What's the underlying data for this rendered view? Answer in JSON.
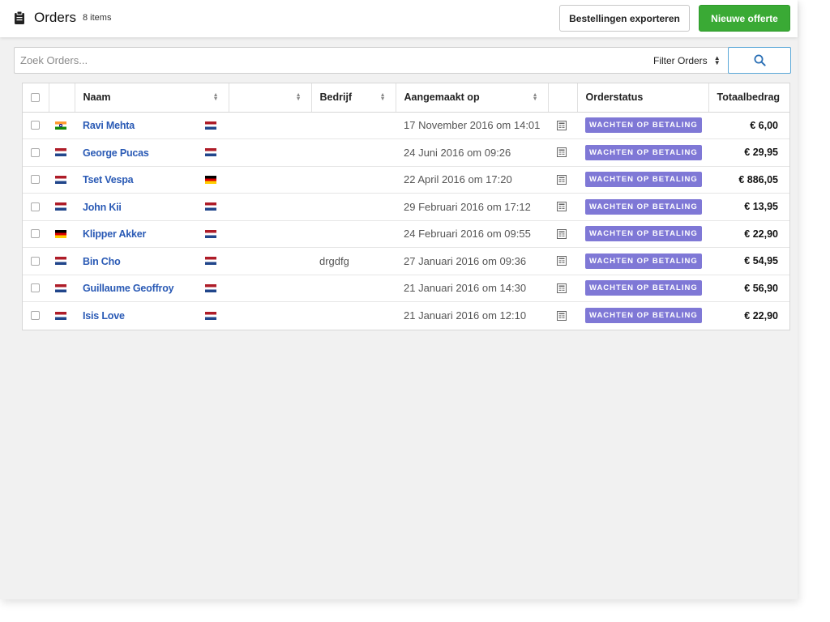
{
  "header": {
    "title": "Orders",
    "count": "8 items",
    "export_label": "Bestellingen exporteren",
    "new_label": "Nieuwe offerte",
    "title_icon": "clipboard-icon"
  },
  "search": {
    "placeholder": "Zoek Orders...",
    "filter_label": "Filter Orders",
    "button_icon": "search-icon"
  },
  "table": {
    "columns": {
      "name": "Naam",
      "company": "Bedrijf",
      "created": "Aangemaakt op",
      "status": "Orderstatus",
      "total": "Totaalbedrag"
    },
    "rows": [
      {
        "country": "in",
        "name": "Ravi Mehta",
        "nationality": "nl",
        "company": "",
        "created": "17 November 2016 om 14:01",
        "status": "WACHTEN OP BETALING",
        "total": "€ 6,00"
      },
      {
        "country": "nl",
        "name": "George Pucas",
        "nationality": "nl",
        "company": "",
        "created": "24 Juni 2016 om 09:26",
        "status": "WACHTEN OP BETALING",
        "total": "€ 29,95"
      },
      {
        "country": "nl",
        "name": "Tset Vespa",
        "nationality": "de",
        "company": "",
        "created": "22 April 2016 om 17:20",
        "status": "WACHTEN OP BETALING",
        "total": "€ 886,05"
      },
      {
        "country": "nl",
        "name": "John Kii",
        "nationality": "nl",
        "company": "",
        "created": "29 Februari 2016 om 17:12",
        "status": "WACHTEN OP BETALING",
        "total": "€ 13,95"
      },
      {
        "country": "de",
        "name": "Klipper Akker",
        "nationality": "nl",
        "company": "",
        "created": "24 Februari 2016 om 09:55",
        "status": "WACHTEN OP BETALING",
        "total": "€ 22,90"
      },
      {
        "country": "nl",
        "name": "Bin Cho",
        "nationality": "nl",
        "company": "drgdfg",
        "created": "27 Januari 2016 om 09:36",
        "status": "WACHTEN OP BETALING",
        "total": "€ 54,95"
      },
      {
        "country": "nl",
        "name": "Guillaume Geoffroy",
        "nationality": "nl",
        "company": "",
        "created": "21 Januari 2016 om 14:30",
        "status": "WACHTEN OP BETALING",
        "total": "€ 56,90"
      },
      {
        "country": "nl",
        "name": "Isis Love",
        "nationality": "nl",
        "company": "",
        "created": "21 Januari 2016 om 12:10",
        "status": "WACHTEN OP BETALING",
        "total": "€ 22,90"
      }
    ]
  },
  "colors": {
    "primary_green": "#3aaa35",
    "status_badge": "#7f78d6",
    "link": "#2a5ab5",
    "search_border": "#5aa8d8"
  }
}
